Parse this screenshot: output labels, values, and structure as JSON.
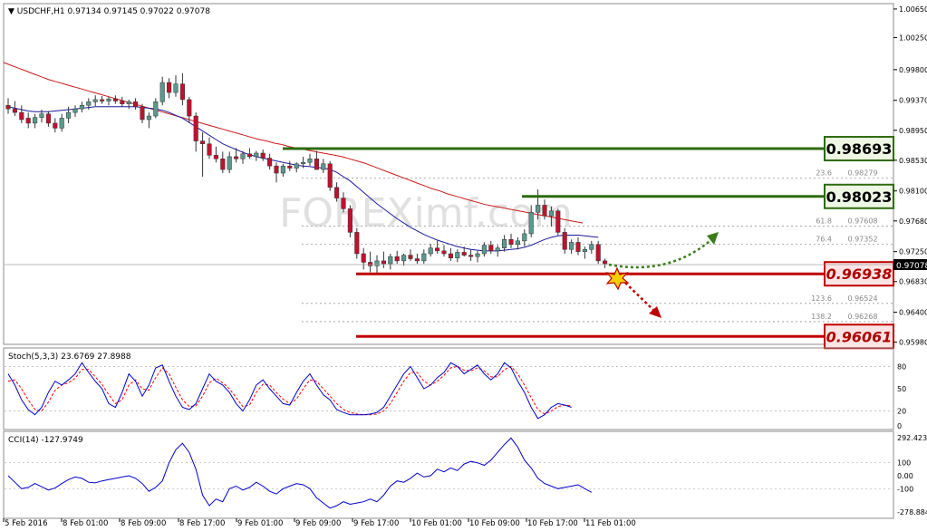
{
  "header": {
    "symbol": "USDCHF,H1",
    "ohlc": "0.97134 0.97145 0.97022 0.97078"
  },
  "watermark": "FOREXimf.com",
  "colors": {
    "bull": "#5a9a8e",
    "bear": "#c2102e",
    "ma_fast": "#1a1a9e",
    "ma_slow": "#cc1a1a",
    "resistance": "#2e6b10",
    "support": "#c00000",
    "stoch_main": "#0000cc",
    "stoch_signal": "#ff0000",
    "cci": "#0000cc"
  },
  "chart_data": [
    {
      "type": "candlestick",
      "title": "USDCHF,H1",
      "ylim": [
        0.9595,
        1.007
      ],
      "price_axis_labels": [
        "1.00650",
        "1.00250",
        "0.99800",
        "0.99370",
        "0.98950",
        "0.98530",
        "0.98100",
        "0.97680",
        "0.97250",
        "0.96830",
        "0.96400",
        "0.95980"
      ],
      "current_price_label": "0.97078",
      "time_axis_labels": [
        "5 Feb 2016",
        "8 Feb 01:00",
        "8 Feb 09:00",
        "8 Feb 17:00",
        "9 Feb 01:00",
        "9 Feb 09:00",
        "9 Feb 17:00",
        "10 Feb 01:00",
        "10 Feb 09:00",
        "10 Feb 17:00",
        "11 Feb 01:00"
      ],
      "candles": [
        [
          0.993,
          0.994,
          0.9918,
          0.9925
        ],
        [
          0.9925,
          0.9936,
          0.9915,
          0.992
        ],
        [
          0.992,
          0.993,
          0.9905,
          0.991
        ],
        [
          0.9912,
          0.992,
          0.9898,
          0.9905
        ],
        [
          0.9905,
          0.9918,
          0.9898,
          0.9913
        ],
        [
          0.9913,
          0.9924,
          0.9906,
          0.9918
        ],
        [
          0.9918,
          0.9922,
          0.99,
          0.9905
        ],
        [
          0.9905,
          0.9912,
          0.9892,
          0.9898
        ],
        [
          0.9898,
          0.9918,
          0.9893,
          0.9912
        ],
        [
          0.9912,
          0.9928,
          0.9905,
          0.992
        ],
        [
          0.992,
          0.993,
          0.9914,
          0.9925
        ],
        [
          0.9925,
          0.9935,
          0.992,
          0.993
        ],
        [
          0.993,
          0.994,
          0.9924,
          0.9935
        ],
        [
          0.9935,
          0.9944,
          0.9929,
          0.9938
        ],
        [
          0.9938,
          0.9943,
          0.9932,
          0.9936
        ],
        [
          0.9936,
          0.9942,
          0.993,
          0.9939
        ],
        [
          0.9939,
          0.9944,
          0.9932,
          0.9936
        ],
        [
          0.9936,
          0.9942,
          0.9928,
          0.9932
        ],
        [
          0.9932,
          0.9938,
          0.9925,
          0.9935
        ],
        [
          0.9935,
          0.994,
          0.9924,
          0.9928
        ],
        [
          0.9928,
          0.9932,
          0.9905,
          0.991
        ],
        [
          0.991,
          0.992,
          0.9898,
          0.9915
        ],
        [
          0.9915,
          0.994,
          0.9912,
          0.9935
        ],
        [
          0.9935,
          0.997,
          0.993,
          0.9962
        ],
        [
          0.9962,
          0.9968,
          0.994,
          0.9948
        ],
        [
          0.9948,
          0.9972,
          0.9942,
          0.996
        ],
        [
          0.996,
          0.9975,
          0.993,
          0.9938
        ],
        [
          0.9938,
          0.9942,
          0.9905,
          0.9915
        ],
        [
          0.9915,
          0.992,
          0.9865,
          0.988
        ],
        [
          0.988,
          0.9892,
          0.983,
          0.9876
        ],
        [
          0.9876,
          0.9885,
          0.9855,
          0.986
        ],
        [
          0.986,
          0.9872,
          0.985,
          0.9855
        ],
        [
          0.9855,
          0.9865,
          0.9835,
          0.984
        ],
        [
          0.984,
          0.9865,
          0.9835,
          0.9858
        ],
        [
          0.9858,
          0.987,
          0.985,
          0.9855
        ],
        [
          0.9855,
          0.9866,
          0.9848,
          0.9862
        ],
        [
          0.9862,
          0.987,
          0.9855,
          0.9858
        ],
        [
          0.9858,
          0.9866,
          0.9852,
          0.9863
        ],
        [
          0.9863,
          0.9868,
          0.9852,
          0.9856
        ],
        [
          0.9856,
          0.9862,
          0.984,
          0.9845
        ],
        [
          0.9845,
          0.985,
          0.9822,
          0.9835
        ],
        [
          0.9835,
          0.9848,
          0.983,
          0.9845
        ],
        [
          0.9845,
          0.9852,
          0.9838,
          0.9842
        ],
        [
          0.9842,
          0.985,
          0.9836,
          0.9848
        ],
        [
          0.9848,
          0.9858,
          0.9842,
          0.985
        ],
        [
          0.985,
          0.9862,
          0.9845,
          0.9855
        ],
        [
          0.9855,
          0.9866,
          0.9846,
          0.984
        ],
        [
          0.984,
          0.9855,
          0.9835,
          0.9848
        ],
        [
          0.9848,
          0.9852,
          0.981,
          0.9815
        ],
        [
          0.9815,
          0.9822,
          0.9795,
          0.98
        ],
        [
          0.98,
          0.9808,
          0.978,
          0.9785
        ],
        [
          0.9785,
          0.979,
          0.9745,
          0.9752
        ],
        [
          0.9752,
          0.9758,
          0.9715,
          0.9722
        ],
        [
          0.9722,
          0.973,
          0.97,
          0.971
        ],
        [
          0.971,
          0.9725,
          0.9696,
          0.9705
        ],
        [
          0.9705,
          0.972,
          0.9694,
          0.9712
        ],
        [
          0.9712,
          0.9725,
          0.9702,
          0.9708
        ],
        [
          0.9708,
          0.9722,
          0.97,
          0.9718
        ],
        [
          0.9718,
          0.9726,
          0.9708,
          0.9712
        ],
        [
          0.9712,
          0.9722,
          0.9705,
          0.972
        ],
        [
          0.972,
          0.9728,
          0.9712,
          0.9715
        ],
        [
          0.9715,
          0.9722,
          0.9708,
          0.9712
        ],
        [
          0.9712,
          0.9728,
          0.9708,
          0.9722
        ],
        [
          0.9722,
          0.9736,
          0.9718,
          0.973
        ],
        [
          0.973,
          0.974,
          0.9722,
          0.9726
        ],
        [
          0.9726,
          0.9734,
          0.9718,
          0.9722
        ],
        [
          0.9722,
          0.973,
          0.9712,
          0.9716
        ],
        [
          0.9716,
          0.9728,
          0.971,
          0.9724
        ],
        [
          0.9724,
          0.9732,
          0.9718,
          0.972
        ],
        [
          0.972,
          0.9728,
          0.9712,
          0.9718
        ],
        [
          0.9718,
          0.9726,
          0.971,
          0.9722
        ],
        [
          0.9722,
          0.9738,
          0.9718,
          0.9734
        ],
        [
          0.9734,
          0.974,
          0.9722,
          0.9726
        ],
        [
          0.9726,
          0.9734,
          0.9718,
          0.973
        ],
        [
          0.973,
          0.9748,
          0.9725,
          0.9742
        ],
        [
          0.9742,
          0.975,
          0.973,
          0.9735
        ],
        [
          0.9735,
          0.9745,
          0.9728,
          0.974
        ],
        [
          0.974,
          0.9756,
          0.9732,
          0.975
        ],
        [
          0.975,
          0.979,
          0.9745,
          0.978
        ],
        [
          0.978,
          0.9812,
          0.977,
          0.979
        ],
        [
          0.979,
          0.9798,
          0.977,
          0.9775
        ],
        [
          0.9775,
          0.9788,
          0.976,
          0.9782
        ],
        [
          0.9782,
          0.9785,
          0.9748,
          0.9752
        ],
        [
          0.9752,
          0.9758,
          0.9722,
          0.9728
        ],
        [
          0.9728,
          0.9742,
          0.9722,
          0.9738
        ],
        [
          0.9738,
          0.9745,
          0.972,
          0.9725
        ],
        [
          0.9725,
          0.9732,
          0.9715,
          0.9728
        ],
        [
          0.9728,
          0.974,
          0.9722,
          0.9735
        ],
        [
          0.9735,
          0.974,
          0.9708,
          0.9712
        ],
        [
          0.9712,
          0.9715,
          0.9702,
          0.9708
        ]
      ],
      "ma_fast": [
        0.9928,
        0.9926,
        0.9924,
        0.9922,
        0.9921,
        0.9921,
        0.9921,
        0.9922,
        0.9923,
        0.9924,
        0.9925,
        0.9926,
        0.9927,
        0.9928,
        0.9928,
        0.9928,
        0.9928,
        0.9928,
        0.9928,
        0.9928,
        0.9927,
        0.9926,
        0.9925,
        0.9923,
        0.992,
        0.9916,
        0.9912,
        0.9906,
        0.99,
        0.9894,
        0.9888,
        0.9882,
        0.9876,
        0.9872,
        0.9868,
        0.9864,
        0.9861,
        0.9858,
        0.9856,
        0.9854,
        0.9852,
        0.985,
        0.9848,
        0.9846,
        0.9845,
        0.9844,
        0.9843,
        0.9842,
        0.984,
        0.9836,
        0.983,
        0.9824,
        0.9816,
        0.9808,
        0.98,
        0.9792,
        0.9785,
        0.9778,
        0.9771,
        0.9765,
        0.9759,
        0.9754,
        0.9749,
        0.9745,
        0.9741,
        0.9738,
        0.9735,
        0.9732,
        0.973,
        0.9728,
        0.9727,
        0.9726,
        0.9726,
        0.9726,
        0.9727,
        0.9728,
        0.9729,
        0.9731,
        0.9734,
        0.9738,
        0.9742,
        0.9745,
        0.9747,
        0.9748,
        0.9748,
        0.9748,
        0.9747,
        0.9746,
        0.9745
      ],
      "ma_slow": [
        0.999,
        0.9986,
        0.9982,
        0.9978,
        0.9974,
        0.997,
        0.9966,
        0.9963,
        0.996,
        0.9957,
        0.9954,
        0.9951,
        0.9948,
        0.9945,
        0.9942,
        0.9939,
        0.9936,
        0.9933,
        0.993,
        0.9927,
        0.9924,
        0.9921,
        0.9918,
        0.9915,
        0.9912,
        0.9909,
        0.9906,
        0.9903,
        0.99,
        0.9897,
        0.9894,
        0.9891,
        0.9888,
        0.9885,
        0.9882,
        0.988,
        0.9877,
        0.9875,
        0.9872,
        0.987,
        0.9868,
        0.9866,
        0.9864,
        0.9862,
        0.986,
        0.9858,
        0.9855,
        0.9852,
        0.9849,
        0.9845,
        0.9841,
        0.9837,
        0.9833,
        0.9829,
        0.9825,
        0.9821,
        0.9817,
        0.9813,
        0.981,
        0.9806,
        0.9803,
        0.98,
        0.9797,
        0.9794,
        0.9791,
        0.9789,
        0.9787,
        0.9785,
        0.9783,
        0.9781,
        0.9779,
        0.9777,
        0.9775,
        0.9773,
        0.9771,
        0.9769,
        0.9767,
        0.9765
      ],
      "levels": [
        {
          "label": "0.98693",
          "value": 0.98693,
          "kind": "resistance"
        },
        {
          "label": "0.98023",
          "value": 0.98023,
          "kind": "resistance"
        },
        {
          "label": "0.96938",
          "value": 0.96938,
          "kind": "support"
        },
        {
          "label": "0.96061",
          "value": 0.96061,
          "kind": "support"
        }
      ],
      "fibonacci": [
        {
          "ratio": "23.6",
          "price": "0.98279",
          "value": 0.98279
        },
        {
          "ratio": "61.8",
          "price": "0.97608",
          "value": 0.97608
        },
        {
          "ratio": "76.4",
          "price": "0.97352",
          "value": 0.97352
        },
        {
          "ratio": "123.6",
          "price": "0.96524",
          "value": 0.96524
        },
        {
          "ratio": "138.2",
          "price": "0.96268",
          "value": 0.96268
        }
      ]
    },
    {
      "type": "line",
      "title": "Stoch(5,3,3) 23.6769 27.8988",
      "ylim": [
        0,
        100
      ],
      "axis_labels": [
        "80",
        "50",
        "20",
        "0"
      ],
      "series": [
        {
          "values": [
            70,
            55,
            35,
            22,
            15,
            25,
            45,
            60,
            55,
            62,
            70,
            85,
            72,
            60,
            50,
            30,
            25,
            45,
            70,
            60,
            40,
            55,
            78,
            82,
            60,
            40,
            25,
            22,
            30,
            50,
            70,
            60,
            55,
            45,
            30,
            20,
            35,
            55,
            62,
            50,
            40,
            30,
            28,
            45,
            60,
            70,
            55,
            42,
            35,
            22,
            18,
            15,
            15,
            15,
            16,
            18,
            25,
            40,
            55,
            70,
            80,
            65,
            50,
            55,
            65,
            72,
            85,
            80,
            70,
            76,
            82,
            70,
            62,
            70,
            85,
            78,
            60,
            45,
            25,
            10,
            15,
            25,
            30,
            28,
            25
          ]
        },
        {
          "values": [
            60,
            62,
            50,
            35,
            22,
            20,
            32,
            48,
            55,
            58,
            64,
            76,
            76,
            66,
            56,
            42,
            30,
            35,
            55,
            62,
            50,
            48,
            65,
            78,
            70,
            52,
            35,
            26,
            27,
            40,
            58,
            64,
            58,
            50,
            38,
            26,
            28,
            45,
            56,
            55,
            45,
            36,
            30,
            36,
            50,
            62,
            60,
            50,
            40,
            30,
            22,
            18,
            16,
            15,
            15,
            16,
            20,
            30,
            45,
            60,
            72,
            72,
            60,
            55,
            60,
            68,
            78,
            80,
            75,
            74,
            78,
            74,
            66,
            66,
            76,
            80,
            70,
            55,
            38,
            22,
            16,
            20,
            26,
            28,
            27
          ]
        }
      ]
    },
    {
      "type": "line",
      "title": "CCI(14) -127.9749",
      "ylim": [
        -300,
        300
      ],
      "axis_labels": [
        "292.423",
        "100",
        "0.00",
        "-100",
        "-278.884"
      ],
      "series": [
        {
          "values": [
            0,
            -50,
            -100,
            -90,
            -60,
            -85,
            -110,
            -95,
            -60,
            -30,
            -10,
            -20,
            -50,
            -55,
            -40,
            -30,
            -20,
            -10,
            0,
            -20,
            -60,
            -120,
            -90,
            -40,
            100,
            200,
            250,
            180,
            50,
            -150,
            -230,
            -180,
            -200,
            -100,
            -80,
            -110,
            -90,
            -50,
            -80,
            -120,
            -140,
            -100,
            -80,
            -60,
            -70,
            -100,
            -170,
            -210,
            -250,
            -230,
            -200,
            -220,
            -210,
            -200,
            -180,
            -200,
            -150,
            -80,
            -40,
            -50,
            -20,
            20,
            -10,
            0,
            50,
            30,
            60,
            40,
            90,
            110,
            100,
            80,
            120,
            180,
            240,
            290,
            220,
            120,
            60,
            -20,
            -60,
            -80,
            -100,
            -90,
            -80,
            -70,
            -100,
            -128
          ]
        }
      ]
    }
  ]
}
